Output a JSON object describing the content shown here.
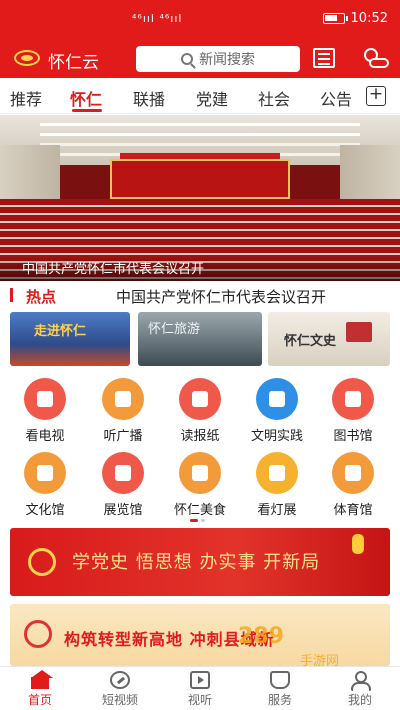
{
  "status_bar": {
    "signal_icons": "⁴⁶ııl ⁴⁶ııl",
    "battery_icon": "battery-icon",
    "time": "10:52"
  },
  "header": {
    "app_name": "怀仁云",
    "search_placeholder": "新闻搜索",
    "icons": [
      "newspaper-icon",
      "weather-icon"
    ]
  },
  "tabs": {
    "items": [
      "推荐",
      "怀仁",
      "联播",
      "党建",
      "社会",
      "公告"
    ],
    "active": "怀仁",
    "add_label": "+"
  },
  "hero": {
    "caption": "中国共产党怀仁市代表会议召开"
  },
  "hot": {
    "label": "热点",
    "headline": "中国共产党怀仁市代表会议召开"
  },
  "cards": [
    {
      "title": "走进怀仁"
    },
    {
      "title": "怀仁旅游"
    },
    {
      "title": "怀仁文史"
    }
  ],
  "grid": {
    "items": [
      {
        "label": "看电视",
        "icon": "tv-icon",
        "color": "#f0584a"
      },
      {
        "label": "听广播",
        "icon": "radio-icon",
        "color": "#f39a3b"
      },
      {
        "label": "读报纸",
        "icon": "newspaper-icon",
        "color": "#f0584a"
      },
      {
        "label": "文明实践",
        "icon": "document-icon",
        "color": "#2e8fe6"
      },
      {
        "label": "图书馆",
        "icon": "library-icon",
        "color": "#f0584a"
      },
      {
        "label": "文化馆",
        "icon": "building-icon",
        "color": "#f39a3b"
      },
      {
        "label": "展览馆",
        "icon": "exhibition-icon",
        "color": "#f0584a"
      },
      {
        "label": "怀仁美食",
        "icon": "food-icon",
        "color": "#f39a3b"
      },
      {
        "label": "看灯展",
        "icon": "lantern-icon",
        "color": "#f6b12e"
      },
      {
        "label": "体育馆",
        "icon": "stadium-icon",
        "color": "#f39a3b"
      }
    ]
  },
  "banners": {
    "banner1": "学党史 悟思想 办实事 开新局",
    "banner2": "构筑转型新高地 冲刺县域新"
  },
  "watermark": {
    "main": "289",
    "sub": "手游网"
  },
  "bottom_nav": {
    "items": [
      {
        "label": "首页",
        "icon": "home-icon"
      },
      {
        "label": "短视频",
        "icon": "compass-icon"
      },
      {
        "label": "视听",
        "icon": "play-icon"
      },
      {
        "label": "服务",
        "icon": "service-icon"
      },
      {
        "label": "我的",
        "icon": "profile-icon"
      }
    ],
    "active": "首页"
  }
}
